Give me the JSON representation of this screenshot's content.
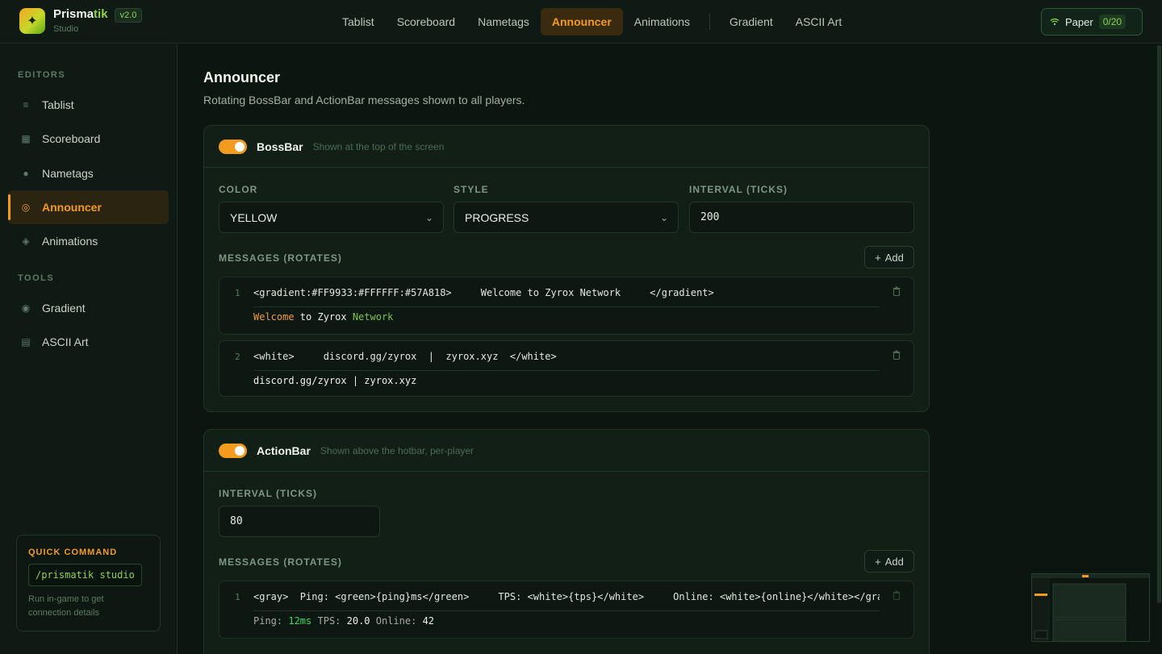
{
  "brand": {
    "name_main": "Prisma",
    "name_accent": "tik",
    "sub": "Studio",
    "version": "v2.0",
    "logo_glyph": "✦"
  },
  "nav": {
    "items": [
      "Tablist",
      "Scoreboard",
      "Nametags",
      "Announcer",
      "Animations",
      "Gradient",
      "ASCII Art"
    ],
    "active": "Announcer"
  },
  "server": {
    "name": "Paper",
    "count": "0/20",
    "icon": "wifi-icon"
  },
  "sidebar": {
    "editors_heading": "EDITORS",
    "editors": [
      {
        "label": "Tablist",
        "icon": "list-icon"
      },
      {
        "label": "Scoreboard",
        "icon": "grid-icon"
      },
      {
        "label": "Nametags",
        "icon": "circle-icon"
      },
      {
        "label": "Announcer",
        "icon": "broadcast-icon"
      },
      {
        "label": "Animations",
        "icon": "diamond-icon"
      }
    ],
    "tools_heading": "TOOLS",
    "tools": [
      {
        "label": "Gradient",
        "icon": "gradient-icon"
      },
      {
        "label": "ASCII Art",
        "icon": "grid-icon"
      }
    ],
    "quick": {
      "title": "QUICK COMMAND",
      "command": "/prismatik studio",
      "note_line1": "Run in-game to get",
      "note_line2": "connection details"
    }
  },
  "page": {
    "title": "Announcer",
    "subtitle": "Rotating BossBar and ActionBar messages shown to all players."
  },
  "bossbar": {
    "title": "BossBar",
    "desc": "Shown at the top of the screen",
    "enabled": true,
    "color_label": "COLOR",
    "color_value": "YELLOW",
    "style_label": "STYLE",
    "style_value": "PROGRESS",
    "interval_label": "INTERVAL (TICKS)",
    "interval_value": "200",
    "messages_label": "MESSAGES (ROTATES)",
    "add_label": "Add",
    "messages": [
      {
        "num": "1",
        "source": "<gradient:#FF9933:#FFFFFF:#57A818>     Welcome to Zyrox Network     </gradient>",
        "preview": [
          {
            "text": "Welcome",
            "color": "#F39B3A"
          },
          {
            "text": " to Zyrox ",
            "color": "#F0F0F0"
          },
          {
            "text": "Network",
            "color": "#7CC34A"
          }
        ]
      },
      {
        "num": "2",
        "source": "<white>     discord.gg/zyrox  |  zyrox.xyz  </white>",
        "preview": [
          {
            "text": "discord.gg/zyrox | zyrox.xyz",
            "color": "#F0F0F0"
          }
        ]
      }
    ]
  },
  "actionbar": {
    "title": "ActionBar",
    "desc": "Shown above the hotbar, per-player",
    "enabled": true,
    "interval_label": "INTERVAL (TICKS)",
    "interval_value": "80",
    "messages_label": "MESSAGES (ROTATES)",
    "add_label": "Add",
    "messages": [
      {
        "num": "1",
        "source": "<gray>  Ping: <green>{ping}ms</green>     TPS: <white>{tps}</white>     Online: <white>{online}</white></gray>",
        "preview": [
          {
            "text": "Ping: ",
            "color": "#A8A8A8"
          },
          {
            "text": "12ms",
            "color": "#3DDC5A"
          },
          {
            "text": " TPS: ",
            "color": "#A8A8A8"
          },
          {
            "text": "20.0",
            "color": "#F0F0F0"
          },
          {
            "text": " Online: ",
            "color": "#A8A8A8"
          },
          {
            "text": "42",
            "color": "#F0F0F0"
          }
        ]
      }
    ]
  },
  "colors": {
    "accent": "#F39B1F",
    "green": "#8FD14F",
    "bg": "#0C1611"
  }
}
